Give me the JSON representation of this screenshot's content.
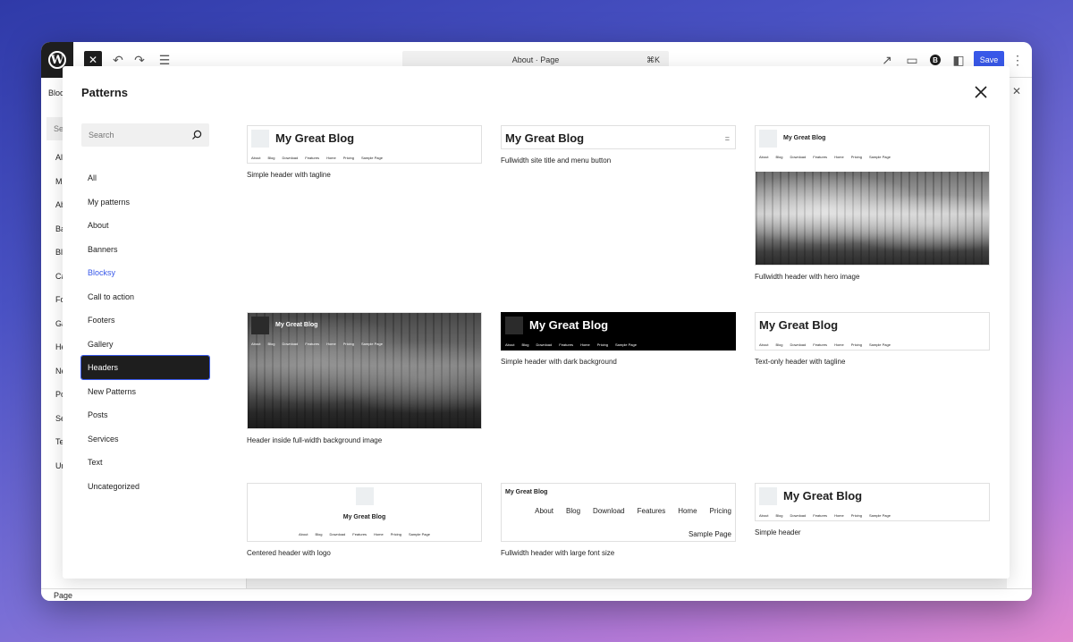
{
  "editor": {
    "document_title": "About · Page",
    "shortcut": "⌘K",
    "save_label": "Save",
    "blocks_tab": "Bloc",
    "sidebar_search": "Se",
    "sidebar_categories": [
      "Al",
      "M",
      "Ab",
      "Ba",
      "Bl",
      "Ca",
      "Fo",
      "Ga",
      "He",
      "Ne",
      "Po",
      "Se",
      "Te",
      "Un"
    ],
    "status": "Page"
  },
  "modal": {
    "title": "Patterns",
    "search_placeholder": "Search",
    "categories": [
      {
        "label": "All"
      },
      {
        "label": "My patterns"
      },
      {
        "label": "About"
      },
      {
        "label": "Banners"
      },
      {
        "label": "Blocksy"
      },
      {
        "label": "Call to action"
      },
      {
        "label": "Footers"
      },
      {
        "label": "Gallery"
      },
      {
        "label": "Headers"
      },
      {
        "label": "New Patterns"
      },
      {
        "label": "Posts"
      },
      {
        "label": "Services"
      },
      {
        "label": "Text"
      },
      {
        "label": "Uncategorized"
      }
    ],
    "active_category": "Headers",
    "accent_category": "Blocksy"
  },
  "site": {
    "title": "My Great Blog",
    "nav": [
      "About",
      "Blog",
      "Download",
      "Features",
      "Home",
      "Pricing",
      "Sample Page"
    ]
  },
  "patterns": [
    {
      "caption": "Simple header with tagline"
    },
    {
      "caption": "Fullwidth site title and menu button"
    },
    {
      "caption": "Fullwidth header with hero image"
    },
    {
      "caption": "Header inside full-width background image"
    },
    {
      "caption": "Simple header with dark background"
    },
    {
      "caption": "Text-only header with tagline"
    },
    {
      "caption": "Centered header with logo"
    },
    {
      "caption": "Fullwidth header with large font size"
    },
    {
      "caption": "Simple header"
    }
  ],
  "colors": {
    "accent": "#3858e9",
    "dark": "#1e1e1e"
  }
}
